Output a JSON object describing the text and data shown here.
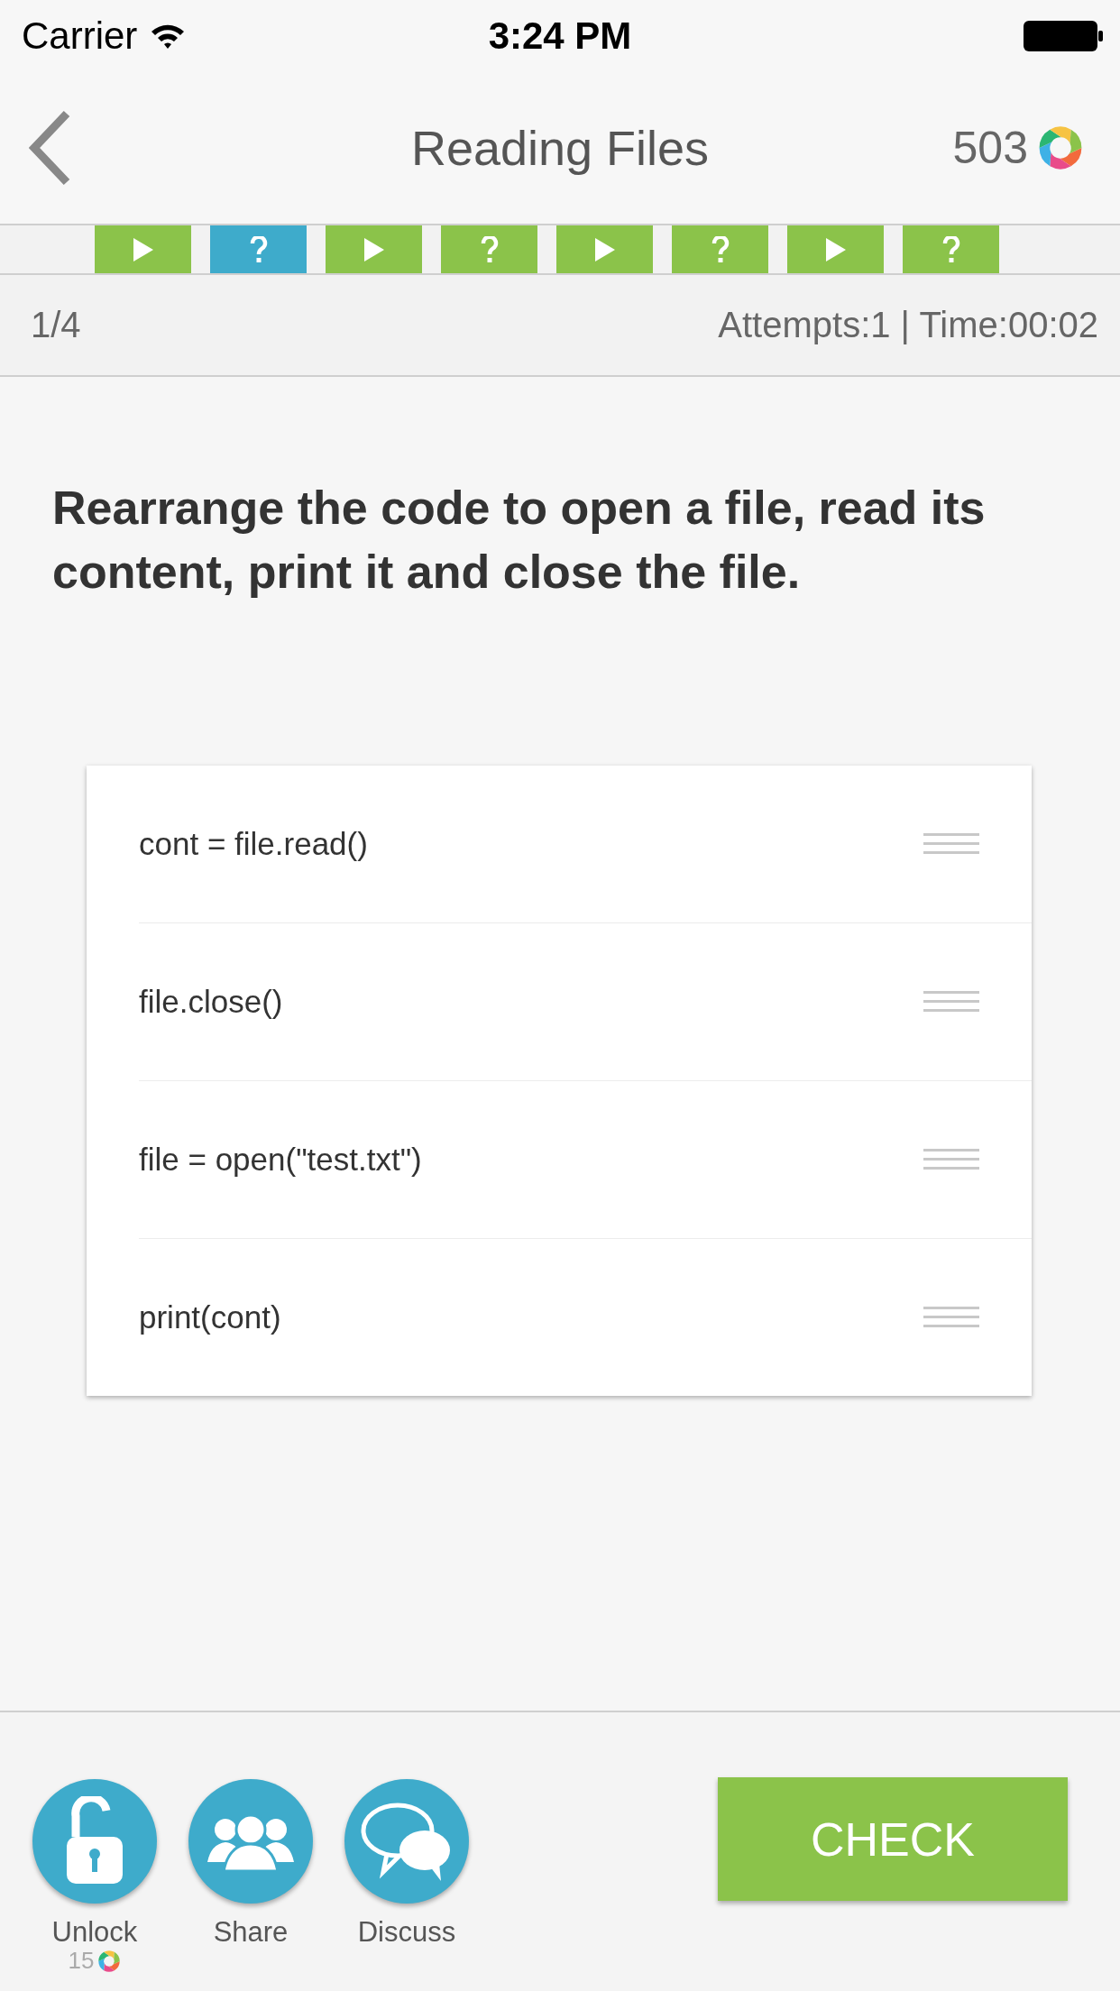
{
  "status_bar": {
    "carrier": "Carrier",
    "time": "3:24 PM"
  },
  "nav": {
    "title": "Reading Files",
    "points": "503"
  },
  "steps": [
    {
      "kind": "play",
      "selected": false
    },
    {
      "kind": "question",
      "selected": true
    },
    {
      "kind": "play",
      "selected": false
    },
    {
      "kind": "question",
      "selected": false
    },
    {
      "kind": "play",
      "selected": false
    },
    {
      "kind": "question",
      "selected": false
    },
    {
      "kind": "play",
      "selected": false
    },
    {
      "kind": "question",
      "selected": false
    }
  ],
  "info": {
    "progress": "1/4",
    "stats": "Attempts:1 | Time:00:02"
  },
  "question": "Rearrange the code to open a file, read its content, print it and close the file.",
  "code_lines": [
    "cont = file.read()",
    "file.close()",
    "file = open(\"test.txt\")",
    "print(cont)"
  ],
  "actions": [
    {
      "kind": "unlock",
      "label": "Unlock",
      "cost": "15"
    },
    {
      "kind": "share",
      "label": "Share"
    },
    {
      "kind": "discuss",
      "label": "Discuss"
    }
  ],
  "check_button": "CHECK"
}
